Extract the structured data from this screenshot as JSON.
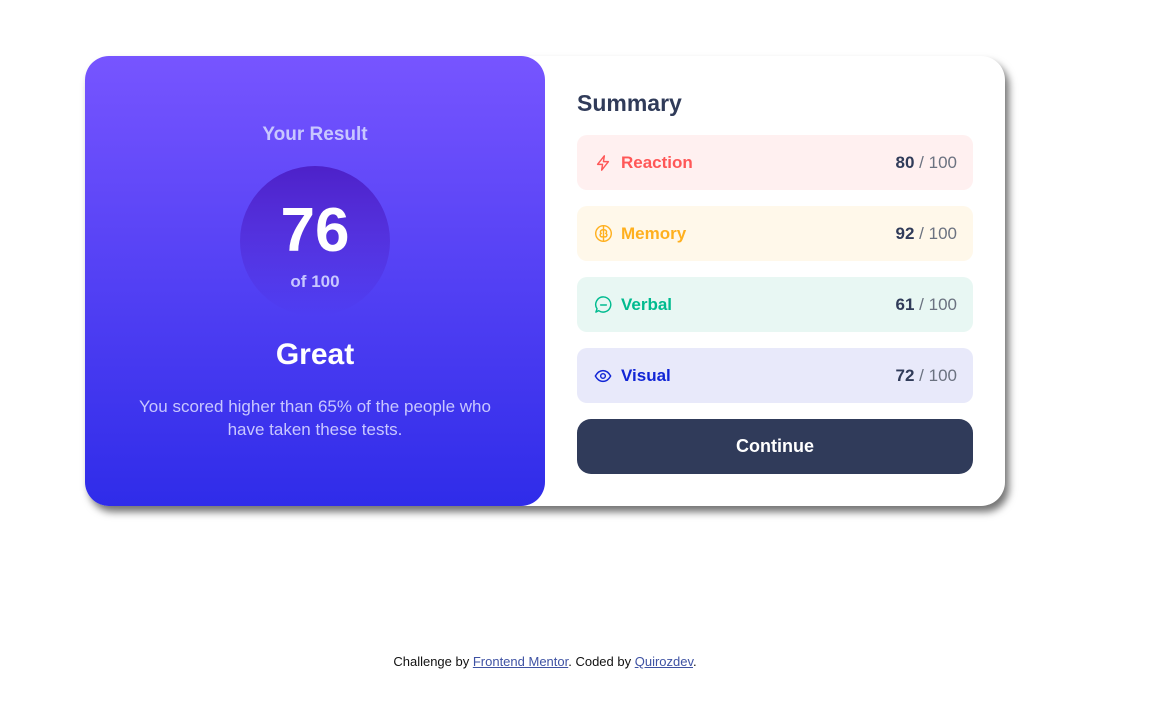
{
  "result": {
    "heading": "Your Result",
    "score": "76",
    "out_of": "of 100",
    "verdict": "Great",
    "description": "You scored higher than 65% of the people who have taken these tests."
  },
  "summary": {
    "title": "Summary",
    "items": [
      {
        "label": "Reaction",
        "score": "80",
        "max": "100",
        "icon": "lightning-icon",
        "color": "#FF5757",
        "bg": "#FFF0F0"
      },
      {
        "label": "Memory",
        "score": "92",
        "max": "100",
        "icon": "brain-icon",
        "color": "#FFB01F",
        "bg": "#FFF8EA"
      },
      {
        "label": "Verbal",
        "score": "61",
        "max": "100",
        "icon": "chat-bubble-icon",
        "color": "#00BB8F",
        "bg": "#E8F7F3"
      },
      {
        "label": "Visual",
        "score": "72",
        "max": "100",
        "icon": "eye-icon",
        "color": "#1125D6",
        "bg": "#E8E9FA"
      }
    ],
    "separator": "/",
    "button_label": "Continue"
  },
  "footer": {
    "prefix": "Challenge by ",
    "link1": "Frontend Mentor",
    "middle": ". Coded by ",
    "link2": "Quirozdev",
    "suffix": "."
  },
  "colors": {
    "gradient_top": "#7755FF",
    "gradient_bottom": "#2F2CE9",
    "button_bg": "#303B5A"
  }
}
